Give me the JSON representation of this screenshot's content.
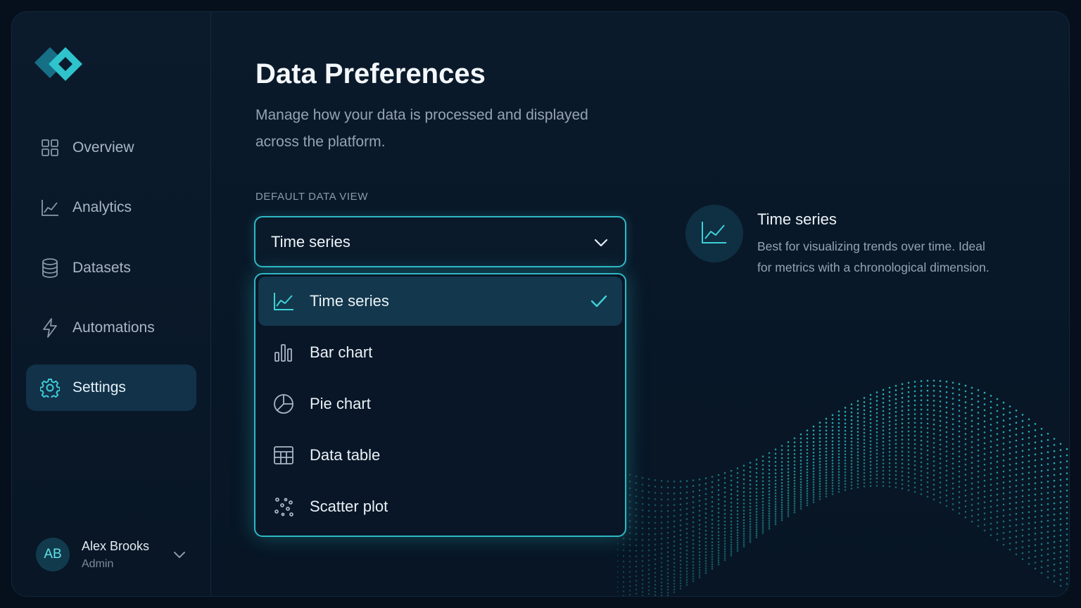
{
  "colors": {
    "accent": "#2fb9c6",
    "accent_bright": "#5fe3e9",
    "background": "#071524",
    "active_bg": "#12324a"
  },
  "sidebar": {
    "logo_icon": "diamond-logo-icon",
    "items": [
      {
        "label": "Overview",
        "icon": "grid-icon",
        "active": false
      },
      {
        "label": "Analytics",
        "icon": "line-chart-icon",
        "active": false
      },
      {
        "label": "Datasets",
        "icon": "database-icon",
        "active": false
      },
      {
        "label": "Automations",
        "icon": "lightning-icon",
        "active": false
      },
      {
        "label": "Settings",
        "icon": "gear-icon",
        "active": true
      }
    ],
    "user": {
      "initials": "AB",
      "name": "Alex Brooks",
      "role": "Admin"
    }
  },
  "main": {
    "title": "Data Preferences",
    "description": "Manage how your data is processed and displayed across the platform.",
    "section_label": "DEFAULT DATA VIEW",
    "select": {
      "value": "Time series"
    },
    "options": [
      {
        "label": "Time series",
        "icon": "line-chart-icon",
        "selected": true
      },
      {
        "label": "Bar chart",
        "icon": "bar-chart-icon",
        "selected": false
      },
      {
        "label": "Pie chart",
        "icon": "pie-chart-icon",
        "selected": false
      },
      {
        "label": "Data table",
        "icon": "table-icon",
        "selected": false
      },
      {
        "label": "Scatter plot",
        "icon": "scatter-icon",
        "selected": false
      }
    ],
    "info": {
      "title": "Time series",
      "description": "Best for visualizing trends over time. Ideal for metrics with a chronological dimension."
    }
  }
}
